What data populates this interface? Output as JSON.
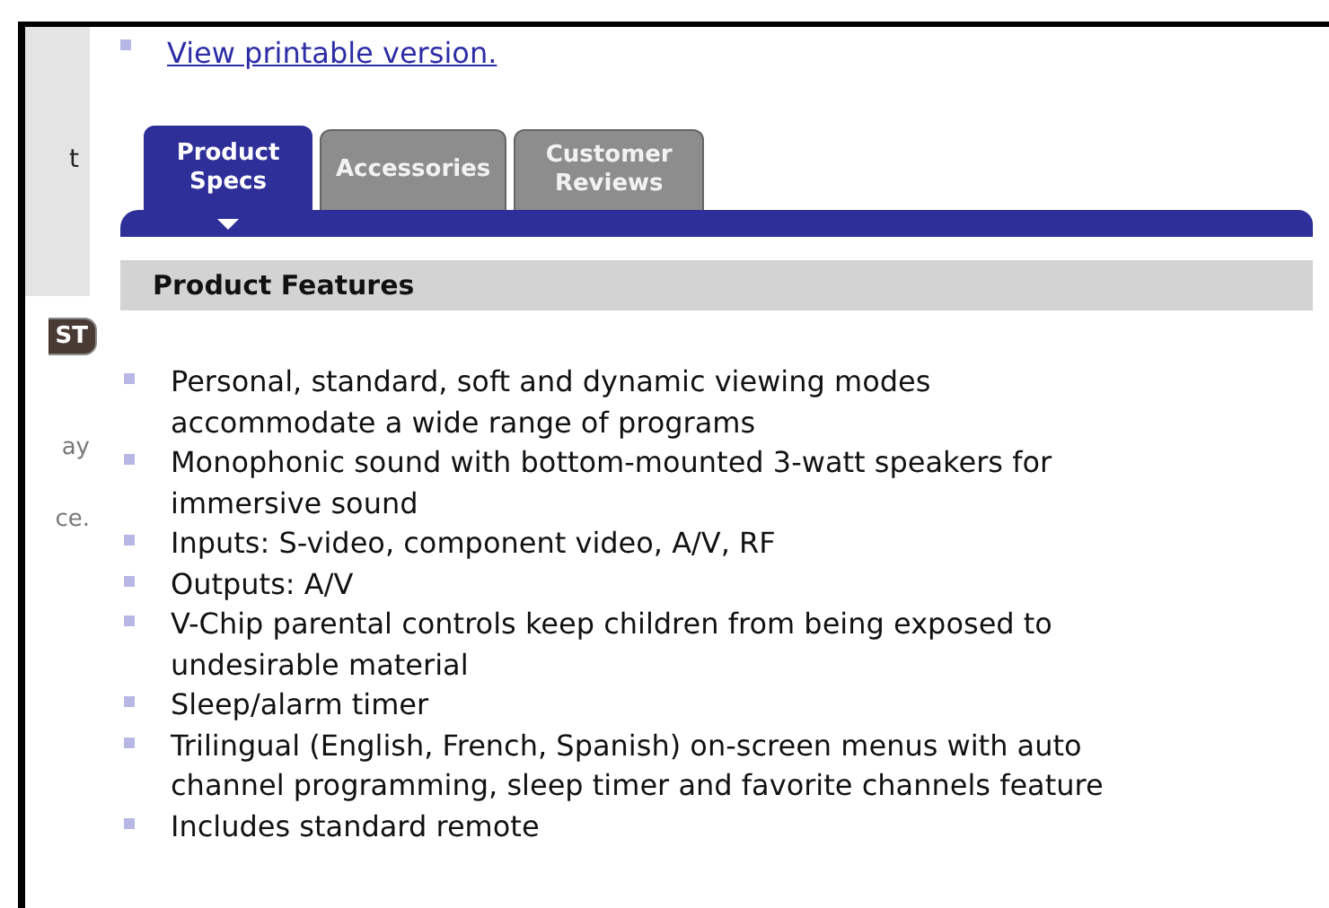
{
  "sidebar": {
    "items": [
      {
        "kind": "text",
        "text": "t"
      },
      {
        "kind": "badge",
        "text": "ST"
      },
      {
        "kind": "text",
        "text": "ay"
      },
      {
        "kind": "text",
        "text": "ce."
      }
    ]
  },
  "printable_link": "View printable version.",
  "tabs": [
    {
      "label": "Product Specs",
      "selected": true
    },
    {
      "label": "Accessories",
      "selected": false
    },
    {
      "label": "Customer Reviews",
      "selected": false
    }
  ],
  "section_title": "Product Features",
  "features": [
    "Personal, standard, soft and dynamic viewing modes accommodate a wide range of programs",
    "Monophonic sound with bottom-mounted 3-watt speakers for immersive sound",
    "Inputs: S-video, component video, A/V, RF",
    "Outputs: A/V",
    "V-Chip parental controls keep children from being exposed to undesirable material",
    "Sleep/alarm timer",
    "Trilingual (English, French, Spanish) on-screen menus with auto channel programming, sleep timer and favorite channels feature",
    "Includes standard remote"
  ]
}
